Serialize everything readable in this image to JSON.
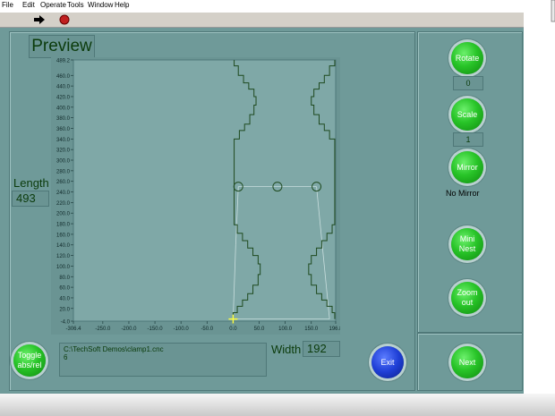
{
  "menu": [
    "File",
    "Edit",
    "Operate",
    "Tools",
    "Window",
    "Help"
  ],
  "preview": {
    "title": "Preview"
  },
  "length": {
    "label": "Length",
    "value": "493"
  },
  "width": {
    "label": "Width",
    "value": "192"
  },
  "path": {
    "line1": "C:\\TechSoft Demos\\clamp1.cnc",
    "line2": "6"
  },
  "buttons": {
    "toggle": "Toggle abs/rel",
    "rotate": "Rotate",
    "scale": "Scale",
    "mirror": "Mirror",
    "mini_nest": "Mini Nest",
    "zoom_out": "Zoom out",
    "exit": "Exit",
    "next": "Next"
  },
  "rotate_value": "0",
  "scale_value": "1",
  "mirror_status": "No Mirror",
  "chart_data": {
    "type": "line",
    "x_ticks": [
      "-306.4",
      "-250.0",
      "-200.0",
      "-150.0",
      "-100.0",
      "-50.0",
      "0.0",
      "50.0",
      "100.0",
      "150.0",
      "196.8"
    ],
    "y_ticks": [
      "-4.0",
      "20.0",
      "40.0",
      "60.0",
      "80.0",
      "100.0",
      "120.0",
      "140.0",
      "160.0",
      "180.0",
      "200.0",
      "220.0",
      "240.0",
      "260.0",
      "280.0",
      "300.0",
      "320.0",
      "340.0",
      "360.0",
      "380.0",
      "400.0",
      "420.0",
      "440.0",
      "460.0",
      "489.2"
    ],
    "xlim": [
      -306.4,
      196.8
    ],
    "ylim": [
      -4,
      489.2
    ],
    "outline": [
      [
        0,
        0
      ],
      [
        5,
        8
      ],
      [
        5,
        140
      ],
      [
        25,
        165
      ],
      [
        50,
        110
      ],
      [
        25,
        55
      ],
      [
        5,
        30
      ]
    ],
    "colors": {
      "outline": "#1f4a1f",
      "construction": "#c9dede",
      "marker": "#ffff40"
    }
  }
}
